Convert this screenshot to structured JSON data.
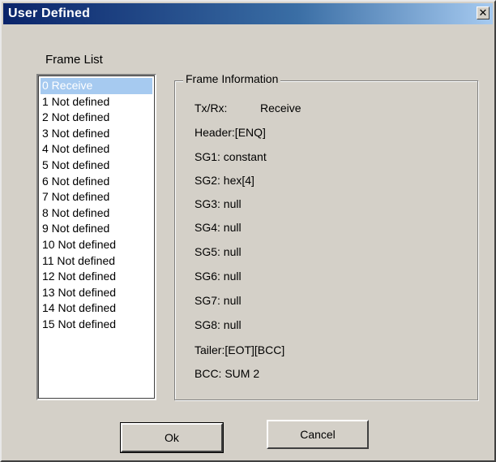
{
  "window": {
    "title": "User Defined",
    "close_glyph": "✕"
  },
  "frame_list": {
    "label": "Frame List",
    "selected_index": 0,
    "items": [
      "0 Receive",
      "1 Not defined",
      "2 Not defined",
      "3 Not defined",
      "4 Not defined",
      "5 Not defined",
      "6 Not defined",
      "7 Not defined",
      "8 Not defined",
      "9 Not defined",
      "10 Not defined",
      "11 Not defined",
      "12 Not defined",
      "13 Not defined",
      "14 Not defined",
      "15 Not defined"
    ]
  },
  "frame_info": {
    "legend": "Frame Information",
    "txrx_label": "Tx/Rx:",
    "txrx_value": "Receive",
    "header": "Header:[ENQ]",
    "sg1": "SG1: constant",
    "sg2": "SG2: hex[4]",
    "sg3": "SG3: null",
    "sg4": "SG4: null",
    "sg5": "SG5: null",
    "sg6": "SG6: null",
    "sg7": "SG7: null",
    "sg8": "SG8: null",
    "tailer": "Tailer:[EOT][BCC]",
    "bcc": "BCC: SUM 2"
  },
  "buttons": {
    "ok_label": "Ok",
    "cancel_label": "Cancel"
  },
  "colors": {
    "title_bar_start": "#0a246a",
    "title_bar_end": "#a6caf0",
    "dialog_face": "#d4d0c8",
    "selection": "#a6caf0"
  }
}
